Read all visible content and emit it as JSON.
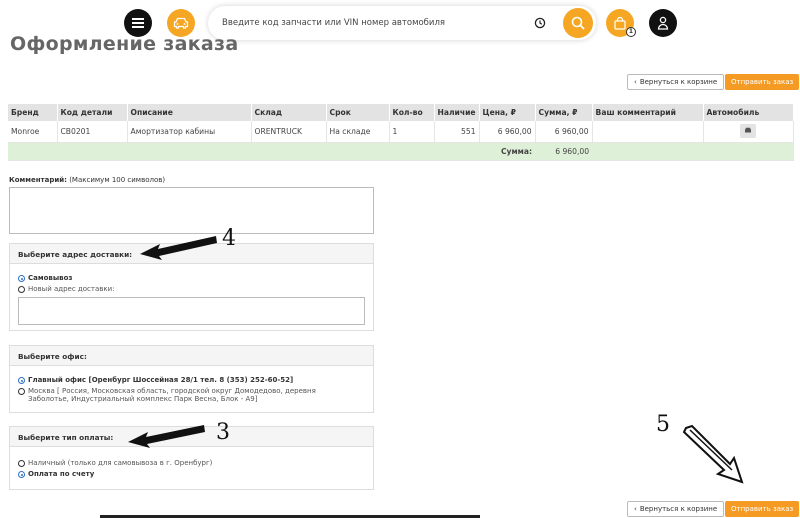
{
  "header": {
    "search_placeholder": "Введите код запчасти или VIN номер автомобиля",
    "cart_count": "1"
  },
  "page_title": "Оформление заказа",
  "actions": {
    "back_label": "Вернуться к корзине",
    "send_label": "Отправить заказ"
  },
  "table": {
    "headers": [
      "Бренд",
      "Код детали",
      "Описание",
      "Склад",
      "Срок",
      "Кол-во",
      "Наличие",
      "Цена, ₽",
      "Сумма, ₽",
      "Ваш комментарий",
      "Автомобиль"
    ],
    "row": {
      "brand": "Monroe",
      "code": "CB0201",
      "description": "Амортизатор кабины",
      "warehouse": "ORENTRUCK",
      "term": "На складе",
      "qty": "1",
      "stock": "551",
      "price": "6 960,00",
      "sum": "6 960,00",
      "comment": ""
    },
    "total_label": "Сумма:",
    "total_value": "6 960,00"
  },
  "comment": {
    "label_bold": "Комментарий:",
    "label_hint": "(Максимум 100 символов)",
    "value": ""
  },
  "delivery": {
    "title": "Выберите адрес доставки:",
    "option_pickup": "Самовывоз",
    "option_new": "Новый адрес доставки:",
    "new_address_value": ""
  },
  "office": {
    "title": "Выберите офис:",
    "option_main": "Главный офис [Оренбург Шоссейная 28/1 тел. 8 (353) 252-60-52]",
    "option_moscow": "Москва [ Россия, Московская область, городской округ Домодедово, деревня Заболотье, Индустриальный комплекс Парк Весна, Блок - А9]"
  },
  "payment": {
    "title": "Выберите тип оплаты:",
    "option_cash": "Наличный (только для самовывоза в г. Оренбург)",
    "option_invoice": "Оплата по счету"
  },
  "annotations": {
    "step4": "4",
    "step3": "3",
    "step5": "5"
  },
  "colors": {
    "accent": "#f59a23",
    "total_row": "#dff0d8",
    "header_gray": "#e3e3e3"
  }
}
